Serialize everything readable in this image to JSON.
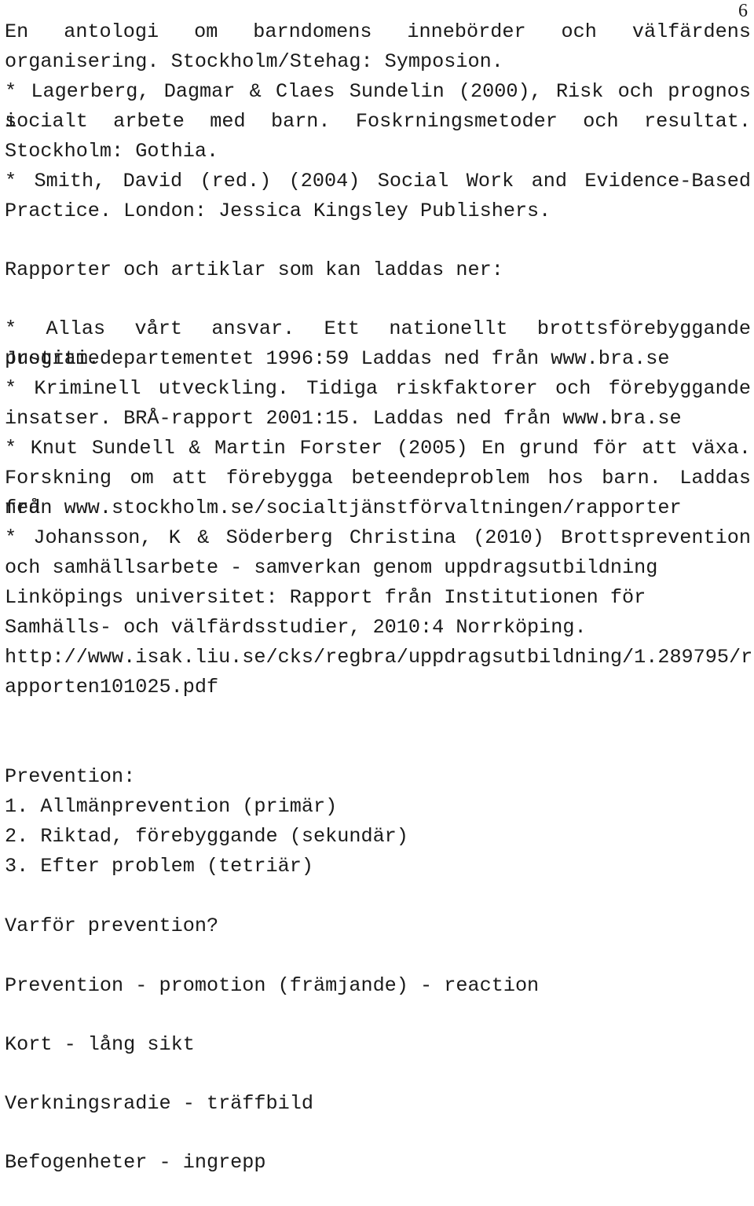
{
  "document": {
    "page_number": "6",
    "language": "sv",
    "paragraphs": {
      "references_continued": [
        "En antologi om barndomens innebörder och välfärdens",
        "organisering. Stockholm/Stehag: Symposion.",
        "* Lagerberg, Dagmar & Claes Sundelin (2000), Risk och prognos i",
        "socialt arbete med barn. Foskrningsmetoder och resultat.",
        "Stockholm: Gothia.",
        "* Smith, David (red.) (2004) Social Work and Evidence-Based",
        "Practice. London: Jessica Kingsley Publishers."
      ],
      "downloadable_heading": "Rapporter och artiklar som kan laddas ner:",
      "downloadable_items": [
        "* Allas vårt ansvar. Ett nationellt brottsförebyggande program.",
        "Justitiedepartementet 1996:59 Laddas ned från www.bra.se",
        "* Kriminell utveckling. Tidiga riskfaktorer och förebyggande",
        "insatser. BRÅ-rapport 2001:15. Laddas ned från www.bra.se",
        "* Knut Sundell & Martin Forster (2005) En grund för att växa.",
        "Forskning om att förebygga beteendeproblem hos barn. Laddas ned",
        "från www.stockholm.se/socialtjänstförvaltningen/rapporter",
        "* Johansson, K & Söderberg Christina (2010) Brottsprevention",
        "och samhällsarbete - samverkan genom uppdragsutbildning",
        "Linköpings universitet: Rapport från Institutionen för",
        "Samhälls- och välfärdsstudier, 2010:4 Norrköping.",
        "http://www.isak.liu.se/cks/regbra/uppdragsutbildning/1.289795/r",
        "apporten101025.pdf"
      ],
      "prevention_heading": "Prevention:",
      "prevention_list": [
        "1. Allmänprevention (primär)",
        "2. Riktad, förebyggande (sekundär)",
        "3. Efter problem (tetriär)"
      ],
      "question": "Varför prevention?",
      "concept_lines": [
        "Prevention - promotion (främjande) - reaction",
        "Kort - lång sikt",
        "Verkningsradie - träffbild",
        "Befogenheter - ingrepp"
      ]
    }
  }
}
